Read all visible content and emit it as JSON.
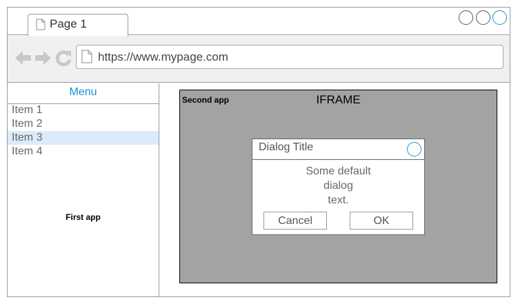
{
  "browser": {
    "tab_label": "Page 1",
    "url": "https://www.mypage.com"
  },
  "left_app": {
    "menu_title": "Menu",
    "items": [
      {
        "label": "Item 1",
        "selected": false
      },
      {
        "label": "Item 2",
        "selected": false
      },
      {
        "label": "Item 3",
        "selected": true
      },
      {
        "label": "Item 4",
        "selected": false
      }
    ],
    "app_label": "First app"
  },
  "iframe": {
    "app_label": "Second app",
    "label": "IFRAME"
  },
  "dialog": {
    "title": "Dialog Title",
    "text_lines": [
      "Some default",
      "dialog",
      "text."
    ],
    "cancel_label": "Cancel",
    "ok_label": "OK"
  },
  "colors": {
    "accent": "#1a8fd6",
    "selection": "#dcebfa",
    "iframe_bg": "#a3a3a3"
  }
}
